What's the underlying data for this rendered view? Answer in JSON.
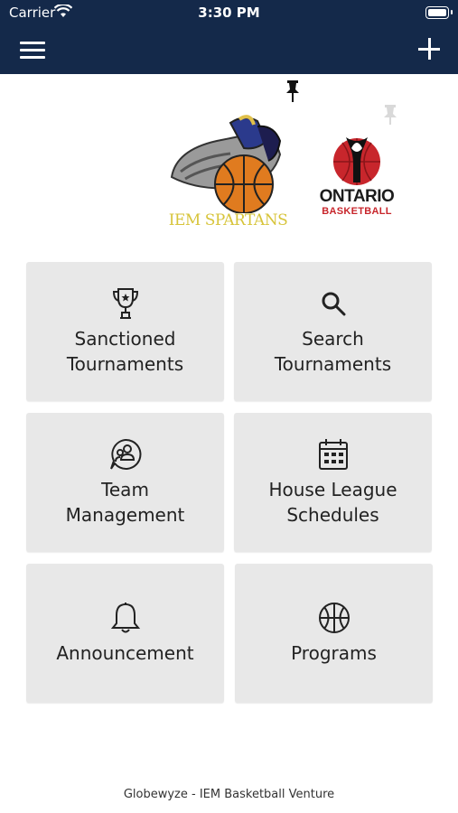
{
  "status_bar": {
    "carrier": "Carrier",
    "time": "3:30 PM"
  },
  "header": {
    "menu_icon": "hamburger-menu-icon",
    "add_icon": "plus-icon",
    "background": "#14294a"
  },
  "logos": {
    "left": {
      "text": "IEM SPARTANS"
    },
    "right": {
      "title": "ONTARIO",
      "subtitle": "BASKETBALL"
    }
  },
  "tiles": [
    {
      "label": "Sanctioned\nTournaments",
      "icon": "trophy-icon"
    },
    {
      "label": "Search\nTournaments",
      "icon": "search-icon"
    },
    {
      "label": "Team\nManagement",
      "icon": "team-icon"
    },
    {
      "label": "House League\nSchedules",
      "icon": "calendar-icon"
    },
    {
      "label": "Announcement",
      "icon": "bell-icon"
    },
    {
      "label": "Programs",
      "icon": "basketball-icon"
    }
  ],
  "footer": {
    "text": "Globewyze - IEM Basketball Venture"
  },
  "colors": {
    "tile_bg": "#e8e8e8",
    "header_bg": "#14294a",
    "spartans_gold": "#d7c43a",
    "ontario_red": "#c8262c"
  }
}
